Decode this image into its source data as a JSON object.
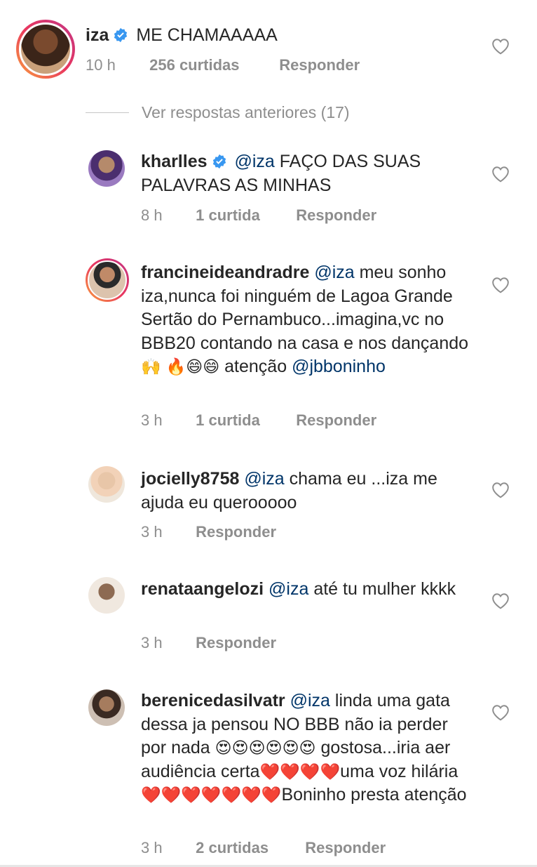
{
  "main_comment": {
    "username": "iza",
    "verified": true,
    "text": "ME CHAMAAAAA",
    "time": "10 h",
    "likes": "256 curtidas",
    "reply": "Responder"
  },
  "view_previous": "Ver respostas anteriores (17)",
  "replies": [
    {
      "username": "kharlles",
      "verified": true,
      "mention": "@iza",
      "text": "FAÇO DAS SUAS PALAVRAS AS MINHAS",
      "time": "8 h",
      "likes": "1 curtida",
      "reply": "Responder"
    },
    {
      "username": "francineideandradre",
      "mention": "@iza",
      "text_a": "meu sonho iza,nunca foi ninguém de Lagoa Grande Sertão do Pernambuco...imagina,vc no BBB20 contando na casa e nos dançando",
      "emoji_a": "🙌",
      "emoji_b": "🔥😄😄",
      "text_b": "atenção",
      "mention_b": "@jbboninho",
      "time": "3 h",
      "likes": "1 curtida",
      "reply": "Responder"
    },
    {
      "username": "jocielly8758",
      "mention": "@iza",
      "text": "chama eu ...iza me ajuda eu querooooo",
      "time": "3 h",
      "reply": "Responder"
    },
    {
      "username": "renataangelozi",
      "mention": "@iza",
      "text": "até tu mulher kkkk",
      "time": "3 h",
      "reply": "Responder"
    },
    {
      "username": "berenicedasilvatr",
      "mention": "@iza",
      "text_a": "linda uma gata dessa ja pensou NO BBB não ia perder por nada",
      "emoji_a": "😍😍😍😍😍😍",
      "text_b": "gostosa...iria aer audiência certa",
      "emoji_b": "❤️❤️❤️❤️",
      "text_c": "uma voz hilária",
      "emoji_c": "❤️❤️❤️❤️❤️❤️❤️",
      "text_d": "Boninho presta atenção",
      "time": "3 h",
      "likes": "2 curtidas",
      "reply": "Responder"
    }
  ],
  "colors": {
    "text": "#262626",
    "meta": "#8e8e8e",
    "mention": "#003569",
    "verified": "#3897f0"
  },
  "icons": {
    "like": "heart-outline-icon",
    "verified": "verified-badge-icon"
  }
}
